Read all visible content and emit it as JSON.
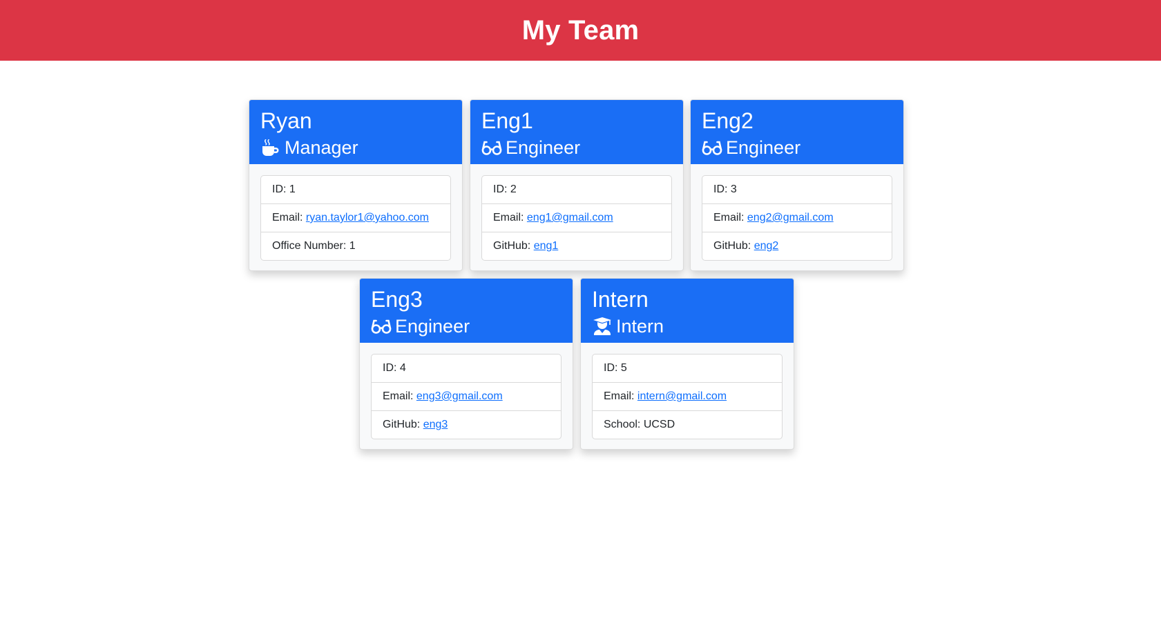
{
  "header": {
    "title": "My Team"
  },
  "colors": {
    "header_bg": "#dc3545",
    "card_header_bg": "#1a6ef5",
    "link": "#0d6efd"
  },
  "employees": [
    {
      "name": "Ryan",
      "role": "Manager",
      "icon": "coffee-icon",
      "id_label": "ID: ",
      "id": "1",
      "email_label": "Email: ",
      "email": "ryan.taylor1@yahoo.com",
      "extra_label": "Office Number: ",
      "extra_value": "1"
    },
    {
      "name": "Eng1",
      "role": "Engineer",
      "icon": "glasses-icon",
      "id_label": "ID: ",
      "id": "2",
      "email_label": "Email: ",
      "email": "eng1@gmail.com",
      "extra_label": "GitHub: ",
      "extra_value": "eng1"
    },
    {
      "name": "Eng2",
      "role": "Engineer",
      "icon": "glasses-icon",
      "id_label": "ID: ",
      "id": "3",
      "email_label": "Email: ",
      "email": "eng2@gmail.com",
      "extra_label": "GitHub: ",
      "extra_value": "eng2"
    },
    {
      "name": "Eng3",
      "role": "Engineer",
      "icon": "glasses-icon",
      "id_label": "ID: ",
      "id": "4",
      "email_label": "Email: ",
      "email": "eng3@gmail.com",
      "extra_label": "GitHub: ",
      "extra_value": "eng3"
    },
    {
      "name": "Intern",
      "role": "Intern",
      "icon": "graduate-icon",
      "id_label": "ID: ",
      "id": "5",
      "email_label": "Email: ",
      "email": "intern@gmail.com",
      "extra_label": "School: ",
      "extra_value": "UCSD"
    }
  ]
}
